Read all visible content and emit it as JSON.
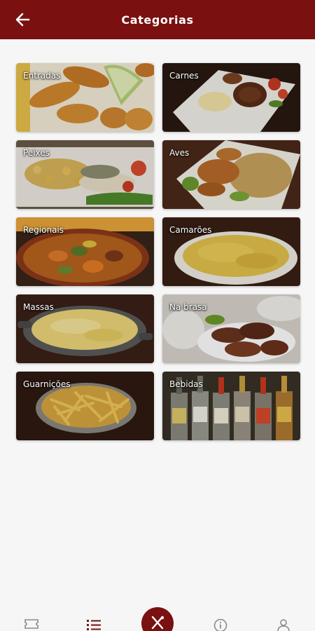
{
  "header": {
    "title": "Categorias",
    "back_icon": "arrow-left-icon"
  },
  "colors": {
    "brand": "#7a1010",
    "background": "#f6f6f6",
    "nav_icon": "#8a8a8a",
    "nav_active": "#7a1010"
  },
  "categories": [
    {
      "label": "Entradas",
      "image": "fried-shrimp-photo"
    },
    {
      "label": "Carnes",
      "image": "steak-plate-photo"
    },
    {
      "label": "Peixes",
      "image": "fish-plate-photo"
    },
    {
      "label": "Aves",
      "image": "chicken-rice-photo"
    },
    {
      "label": "Regionais",
      "image": "stew-bowl-photo"
    },
    {
      "label": "Camarões",
      "image": "shrimp-rice-photo"
    },
    {
      "label": "Massas",
      "image": "pasta-pan-photo"
    },
    {
      "label": "Na brasa",
      "image": "grilled-meat-photo"
    },
    {
      "label": "Guarnições",
      "image": "french-fries-photo"
    },
    {
      "label": "Bebidas",
      "image": "beer-bottles-photo"
    }
  ],
  "bottom_nav": {
    "items": [
      {
        "icon": "ticket-icon"
      },
      {
        "icon": "menu-list-icon",
        "active": true
      },
      {
        "icon": "cutlery-icon",
        "center": true
      },
      {
        "icon": "info-icon"
      },
      {
        "icon": "user-icon"
      }
    ]
  }
}
